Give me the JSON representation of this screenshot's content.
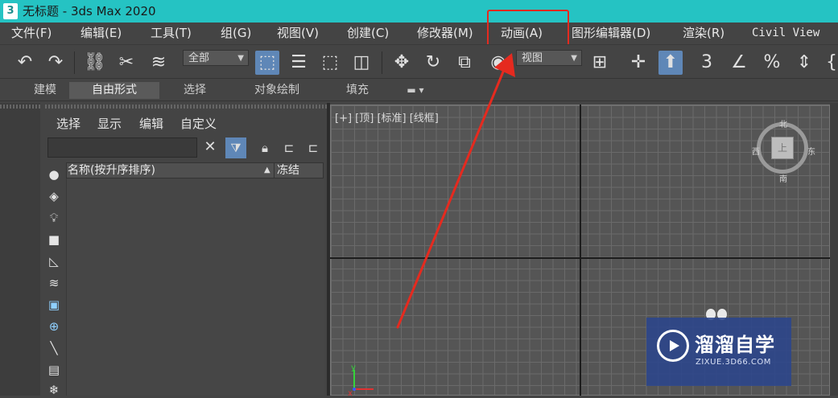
{
  "titlebar": {
    "app_icon_text": "3",
    "title": "无标题 - 3ds Max 2020"
  },
  "menubar": {
    "items": [
      "文件(F)",
      "编辑(E)",
      "工具(T)",
      "组(G)",
      "视图(V)",
      "创建(C)",
      "修改器(M)",
      "动画(A)",
      "图形编辑器(D)",
      "渲染(R)",
      "Civil View"
    ],
    "highlighted": "动画(A)",
    "highlight_color": "#e52a1f"
  },
  "toolbar": {
    "selection_filter": "全部",
    "ref_coord": "视图",
    "icons": [
      "undo-icon",
      "redo-icon",
      "link-icon",
      "unlink-icon",
      "bind-spacewarp-icon",
      "select-object-icon",
      "select-by-name-icon",
      "rect-region-icon",
      "window-crossing-icon",
      "move-icon",
      "rotate-icon",
      "scale-icon",
      "placement-icon",
      "pivot-icon",
      "keyboard-shortcut-icon",
      "snap-3-icon",
      "angle-snap-icon",
      "percent-snap-icon",
      "spinner-snap-icon"
    ]
  },
  "ribbon": {
    "tabs": [
      "建模",
      "自由形式",
      "选择",
      "对象绘制",
      "填充"
    ],
    "active": "自由形式"
  },
  "explorer": {
    "menu": [
      "选择",
      "显示",
      "编辑",
      "自定义"
    ],
    "column_name": "名称(按升序排序)",
    "column_freeze": "冻结",
    "search_placeholder": ""
  },
  "viewport": {
    "label": "[+] [顶] [标准] [线框]",
    "compass": {
      "north": "北",
      "south": "南",
      "east": "东",
      "west": "西"
    },
    "cube_face": "上",
    "axis_x": "x",
    "axis_y": "y"
  },
  "watermark": {
    "title": "溜溜自学",
    "subtitle": "ZIXUE.3D66.COM"
  },
  "annotation": {
    "arrow_color": "#e52a1f"
  }
}
